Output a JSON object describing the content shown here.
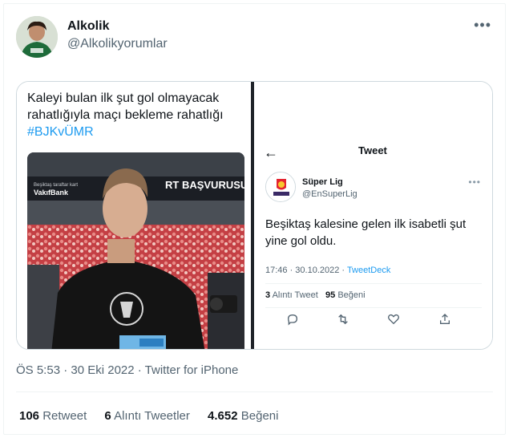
{
  "author": {
    "display_name": "Alkolik",
    "handle": "@Alkolikyorumlar",
    "avatar_icon": "avatar-photo",
    "more_icon": "more-horizontal-icon"
  },
  "tweet": {
    "text_line1": "Kaleyi bulan ilk şut gol olmayacak",
    "text_line2": "rahatlığıyla maçı bekleme rahatlığı",
    "hashtag": "#BJKvÜMR",
    "photo_banner_left": "Beşiktaş taraftar kart",
    "photo_banner_brand": "VakıfBank",
    "photo_banner_right": "RT BAŞVURUSU",
    "timestamp": "ÖS 5:53 · 30 Eki 2022 · Twitter for iPhone"
  },
  "embedded": {
    "header_title": "Tweet",
    "name": "Süper Lig",
    "handle": "@EnSuperLig",
    "avatar_text": "EnSüperLig",
    "text": "Beşiktaş kalesine gelen ilk isabetli şut yine gol oldu.",
    "time": "17:46 · 30.10.2022 · ",
    "app": "TweetDeck",
    "retweet_count": "3",
    "retweet_label": "Alıntı Tweet",
    "like_count": "95",
    "like_label": "Beğeni",
    "actions": [
      "reply-icon",
      "retweet-icon",
      "like-icon",
      "share-icon"
    ]
  },
  "stats": {
    "retweets": "106",
    "retweets_label": "Retweet",
    "quotes": "6",
    "quotes_label": "Alıntı Tweetler",
    "likes": "4.652",
    "likes_label": "Beğeni"
  },
  "colors": {
    "accent": "#1d9bf0",
    "secondary_text": "#536471",
    "divider": "#1f2329"
  }
}
